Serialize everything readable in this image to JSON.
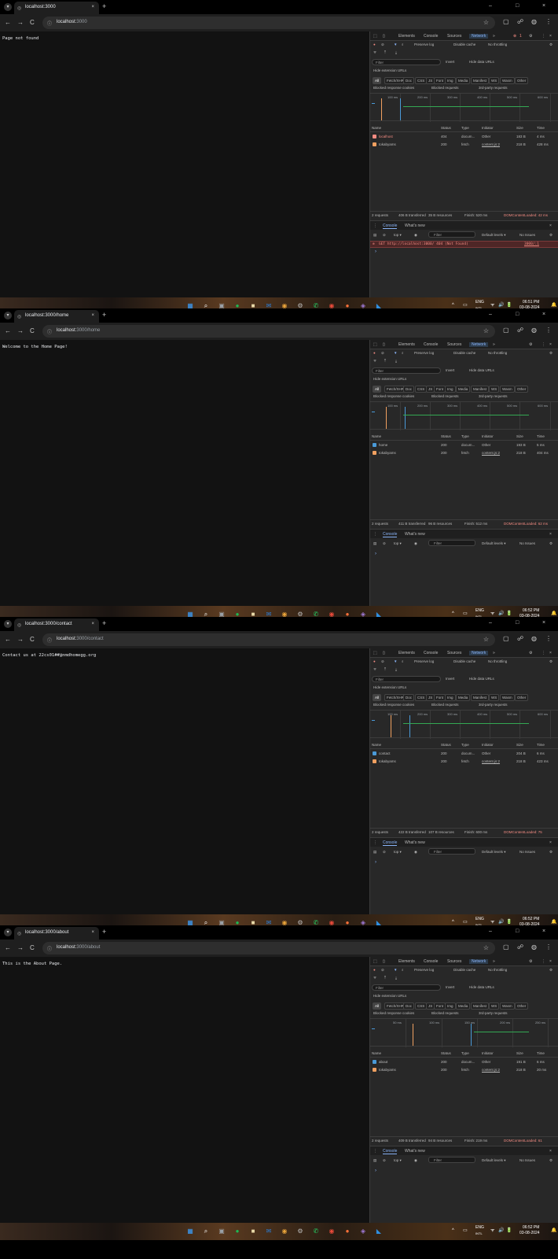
{
  "browser": {
    "close_tab": "×",
    "new_tab": "+",
    "window_minimize": "–",
    "window_restore": "□",
    "window_close": "×",
    "nav_back": "←",
    "nav_forward": "→",
    "nav_reload": "C",
    "url_host": "localhost:",
    "star": "☆"
  },
  "devtools": {
    "tabs": [
      "Elements",
      "Console",
      "Sources",
      "Network",
      "»"
    ],
    "preserve_log": "Preserve log",
    "disable_cache": "Disable cache",
    "throttling": "No throttling",
    "filter_placeholder": "Filter",
    "invert": "Invert",
    "hide_data_urls": "Hide data URLs",
    "hide_extension_urls": "Hide extension URLs",
    "type_chips": [
      "All",
      "Fetch/XHR",
      "Doc",
      "CSS",
      "JS",
      "Font",
      "Img",
      "Media",
      "Manifest",
      "WS",
      "Wasm",
      "Other"
    ],
    "blocked_cookies": "Blocked response cookies",
    "blocked_requests": "Blocked requests",
    "third_party": "3rd-party requests",
    "columns": [
      "Name",
      "Status",
      "Type",
      "Initiator",
      "Size",
      "Time"
    ],
    "drawer_tabs": [
      "Console",
      "What's new"
    ],
    "console_context": "top ▾",
    "console_filter": "Filter",
    "default_levels": "Default levels ▾",
    "no_issues": "No Issues"
  },
  "shots": [
    {
      "tab_title": "localhost:3000",
      "url_path": "3000",
      "page_text": "Page not found",
      "error_badge": "1",
      "timeline_ticks": [
        "100 ms",
        "200 ms",
        "300 ms",
        "400 ms",
        "500 ms",
        "600 ms"
      ],
      "requests": [
        {
          "name": "localhost",
          "status": "404",
          "type": "docum...",
          "initiator": "Other",
          "size": "183 B",
          "time": "4 ms",
          "icon_color": "#f28b82"
        },
        {
          "name": "tokabyams",
          "status": "200",
          "type": "fetch",
          "initiator": "content.js:2",
          "size": "218 B",
          "time": "428 ms",
          "icon_color": "#f0a060"
        }
      ],
      "status_bar": [
        "2 requests",
        "406 B transferred",
        "35 B resources",
        "Finish: 520 ms"
      ],
      "dom_loaded": "DOMContentLoaded: 42 ms",
      "console_error": "GET http://localhost:3000/ 404 (Not Found)",
      "console_error_src": "3000/:1",
      "prompt": "›",
      "time": "06:51 PM",
      "date": "03-08-2024"
    },
    {
      "tab_title": "localhost:3000/home",
      "url_path": "3000/home",
      "page_text": "Welcome to the Home Page!",
      "error_badge": "",
      "timeline_ticks": [
        "100 ms",
        "200 ms",
        "300 ms",
        "400 ms",
        "500 ms",
        "600 ms"
      ],
      "requests": [
        {
          "name": "home",
          "status": "200",
          "type": "docum...",
          "initiator": "Other",
          "size": "193 B",
          "time": "5 ms",
          "icon_color": "#4a9ad8"
        },
        {
          "name": "tokabyams",
          "status": "200",
          "type": "fetch",
          "initiator": "content.js:2",
          "size": "218 B",
          "time": "404 ms",
          "icon_color": "#f0a060"
        }
      ],
      "status_bar": [
        "2 requests",
        "411 B transferred",
        "96 B resources",
        "Finish: 512 ms"
      ],
      "dom_loaded": "DOMContentLoaded: 62 ms",
      "console_error": "",
      "console_error_src": "",
      "prompt": "›",
      "time": "06:52 PM",
      "date": "03-08-2024"
    },
    {
      "tab_title": "localhost:3000/contact",
      "url_path": "3000/contact",
      "page_text": "Contact us at 22cs01##@nmdhomegg.org",
      "error_badge": "",
      "timeline_ticks": [
        "100 ms",
        "200 ms",
        "300 ms",
        "400 ms",
        "500 ms",
        "600 ms"
      ],
      "requests": [
        {
          "name": "contact",
          "status": "200",
          "type": "docum...",
          "initiator": "Other",
          "size": "204 B",
          "time": "6 ms",
          "icon_color": "#4a9ad8"
        },
        {
          "name": "tokabyams",
          "status": "200",
          "type": "fetch",
          "initiator": "content.js:2",
          "size": "218 B",
          "time": "423 ms",
          "icon_color": "#f0a060"
        }
      ],
      "status_bar": [
        "2 requests",
        "422 B transferred",
        "107 B resources",
        "Finish: 600 ms"
      ],
      "dom_loaded": "DOMContentLoaded: 75",
      "console_error": "",
      "console_error_src": "",
      "prompt": "›",
      "time": "06:52 PM",
      "date": "03-08-2024"
    },
    {
      "tab_title": "localhost:3000/about",
      "url_path": "3000/about",
      "page_text": "This is the About Page.",
      "error_badge": "",
      "timeline_ticks": [
        "50 ms",
        "100 ms",
        "150 ms",
        "200 ms",
        "250 ms"
      ],
      "requests": [
        {
          "name": "about",
          "status": "200",
          "type": "docum...",
          "initiator": "Other",
          "size": "191 B",
          "time": "6 ms",
          "icon_color": "#4a9ad8"
        },
        {
          "name": "tokabyams",
          "status": "200",
          "type": "fetch",
          "initiator": "content.js:2",
          "size": "218 B",
          "time": "20 ms",
          "icon_color": "#f0a060"
        }
      ],
      "status_bar": [
        "2 requests",
        "409 B transferred",
        "94 B resources",
        "Finish: 219 ms"
      ],
      "dom_loaded": "DOMContentLoaded: 61",
      "console_error": "",
      "console_error_src": "",
      "prompt": "›",
      "time": "06:52 PM",
      "date": "03-08-2024"
    }
  ],
  "taskbar": {
    "lang": "ENG",
    "lang_sub": "INTL",
    "icons": [
      {
        "name": "windows-start-icon",
        "glyph": "▦",
        "color": "#3aa0ff"
      },
      {
        "name": "search-icon",
        "glyph": "⌕",
        "color": "#ffffff"
      },
      {
        "name": "file-explorer-icon",
        "glyph": "▣",
        "color": "#9aa0a6"
      },
      {
        "name": "spotify-icon",
        "glyph": "●",
        "color": "#1db954"
      },
      {
        "name": "notes-app-icon",
        "glyph": "■",
        "color": "#e8d9a8"
      },
      {
        "name": "mail-icon",
        "glyph": "✉",
        "color": "#2b7fd9"
      },
      {
        "name": "chrome-icon",
        "glyph": "◉",
        "color": "#e8a33a"
      },
      {
        "name": "settings-icon",
        "glyph": "⚙",
        "color": "#bbbbbb"
      },
      {
        "name": "whatsapp-icon",
        "glyph": "✆",
        "color": "#25d366"
      },
      {
        "name": "chrome-alt-icon",
        "glyph": "◉",
        "color": "#e84a3a"
      },
      {
        "name": "firefox-icon",
        "glyph": "●",
        "color": "#ff7139"
      },
      {
        "name": "github-desktop-icon",
        "glyph": "◈",
        "color": "#a07ad9"
      },
      {
        "name": "vscode-icon",
        "glyph": "◣",
        "color": "#2f8fe0"
      }
    ],
    "tray_icons": [
      "^",
      "▭",
      "⌨",
      "ᯤ",
      "🔊",
      "🔋"
    ]
  }
}
